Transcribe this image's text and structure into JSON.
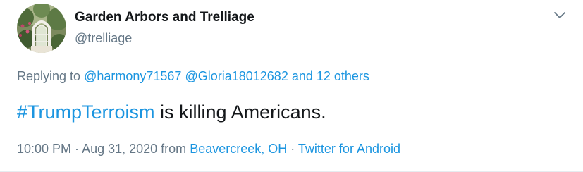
{
  "tweet": {
    "author": {
      "display_name": "Garden Arbors and Trelliage",
      "handle": "@trelliage"
    },
    "replying_to": {
      "prefix": "Replying to",
      "users": [
        "@harmony71567",
        "@Gloria18012682"
      ],
      "others": "and 12 others"
    },
    "text": {
      "hashtag": "#TrumpTerroism",
      "body": " is killing Americans."
    },
    "meta": {
      "time": "10:00 PM",
      "sep1": " · ",
      "date": "Aug 31, 2020",
      "from": " from ",
      "location": "Beavercreek, OH",
      "sep2": " · ",
      "client": "Twitter for Android"
    },
    "icons": {
      "menu": "chevron-down-icon",
      "avatar": "garden-arbor-avatar"
    },
    "colors": {
      "link": "#1b95e0",
      "secondary": "#657786",
      "primary": "#14171a"
    }
  }
}
